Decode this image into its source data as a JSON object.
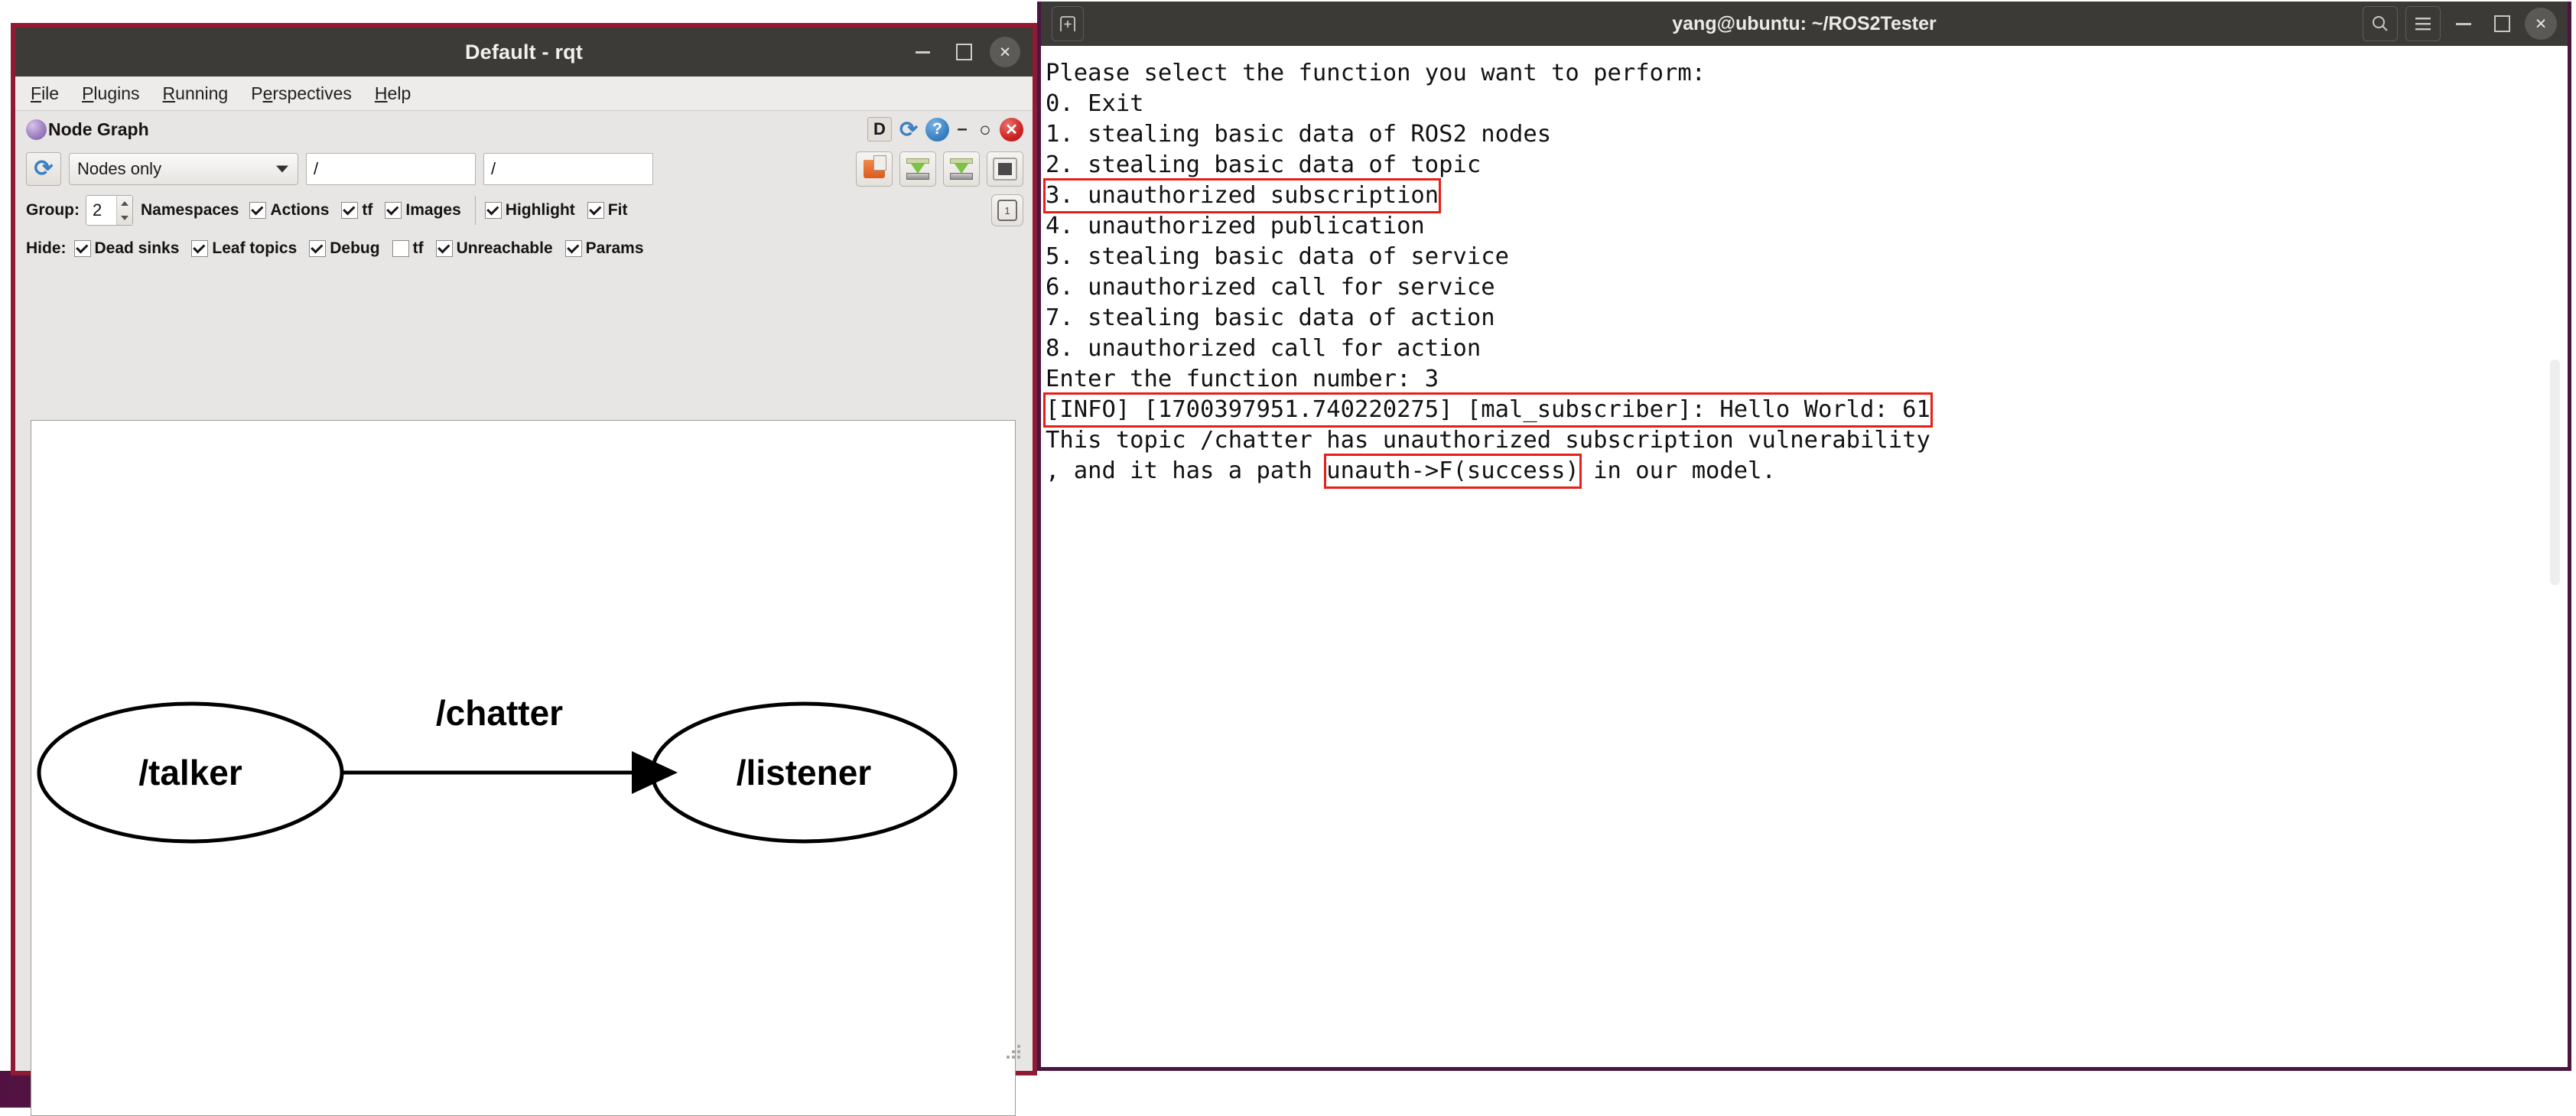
{
  "rqt": {
    "title": "Default - rqt",
    "window_buttons": [
      {
        "name": "minimize-button",
        "glyph": "minimize"
      },
      {
        "name": "maximize-button",
        "glyph": "maximize"
      },
      {
        "name": "close-button",
        "glyph": "×"
      }
    ],
    "menubar": [
      {
        "mnemonic": "F",
        "rest": "ile"
      },
      {
        "mnemonic": "P",
        "rest": "lugins"
      },
      {
        "mnemonic": "R",
        "rest": "unning"
      },
      {
        "mnemonic": "P",
        "rest": "erspectives",
        "pre": ""
      },
      {
        "mnemonic": "H",
        "rest": "elp"
      }
    ],
    "dock": {
      "title": "Node Graph",
      "header_buttons": {
        "d_label": "D",
        "refresh": "⟳",
        "help": "?",
        "minimize": "-",
        "float": "○",
        "close": "✕"
      }
    },
    "toolbar": {
      "refresh_tooltip": "refresh",
      "graph_type": "Nodes only",
      "filter_namespace": "/",
      "filter_topic": "/",
      "group_label": "Group:",
      "group_value": "2",
      "namespaces_label": "Namespaces",
      "checks_row1": [
        {
          "label": "Actions",
          "checked": true
        },
        {
          "label": "tf",
          "checked": true
        },
        {
          "label": "Images",
          "checked": true
        }
      ],
      "checks_row1b": [
        {
          "label": "Highlight",
          "checked": true
        },
        {
          "label": "Fit",
          "checked": true
        }
      ],
      "hide_label": "Hide:",
      "checks_row2": [
        {
          "label": "Dead sinks",
          "checked": true
        },
        {
          "label": "Leaf topics",
          "checked": true
        },
        {
          "label": "Debug",
          "checked": true
        },
        {
          "label": "tf",
          "checked": false
        },
        {
          "label": "Unreachable",
          "checked": true
        },
        {
          "label": "Params",
          "checked": true
        }
      ]
    },
    "graph": {
      "nodes": [
        {
          "id": "talker",
          "label": "/talker"
        },
        {
          "id": "listener",
          "label": "/listener"
        }
      ],
      "edges": [
        {
          "from": "talker",
          "to": "listener",
          "label": "/chatter"
        }
      ]
    }
  },
  "terminal": {
    "title": "yang@ubuntu: ~/ROS2Tester",
    "new_tab_icon": "new-tab",
    "buttons": [
      {
        "name": "search-button",
        "glyph": "search"
      },
      {
        "name": "menu-button",
        "glyph": "hamburger"
      },
      {
        "name": "minimize-button",
        "glyph": "minimize"
      },
      {
        "name": "maximize-button",
        "glyph": "maximize"
      },
      {
        "name": "close-button",
        "glyph": "×"
      }
    ],
    "lines": [
      {
        "text": "Please select the function you want to perform:",
        "highlight": null
      },
      {
        "text": "0. Exit",
        "highlight": null
      },
      {
        "text": "1. stealing basic data of ROS2 nodes",
        "highlight": null
      },
      {
        "text": "2. stealing basic data of topic",
        "highlight": null
      },
      {
        "text": "3. unauthorized subscription",
        "highlight": "full"
      },
      {
        "text": "4. unauthorized publication",
        "highlight": null
      },
      {
        "text": "5. stealing basic data of service",
        "highlight": null
      },
      {
        "text": "6. unauthorized call for service",
        "highlight": null
      },
      {
        "text": "7. stealing basic data of action",
        "highlight": null
      },
      {
        "text": "8. unauthorized call for action",
        "highlight": null
      },
      {
        "text": "Enter the function number: 3",
        "highlight": null
      },
      {
        "text": "[INFO] [1700397951.740220275] [mal_subscriber]: Hello World: 61",
        "highlight": "full"
      },
      {
        "text": "This topic /chatter has unauthorized subscription vulnerability",
        "highlight": null
      },
      {
        "pre": ", and it has a path ",
        "mid": "unauth->F(success)",
        "post": " in our model.",
        "highlight": "partial"
      }
    ]
  },
  "colors": {
    "rqt_border": "#8e1b33",
    "terminal_border": "#4b1540",
    "highlight_red": "#e81e18",
    "titlebar": "#3b3a37",
    "desktop_purple": "#511241"
  }
}
